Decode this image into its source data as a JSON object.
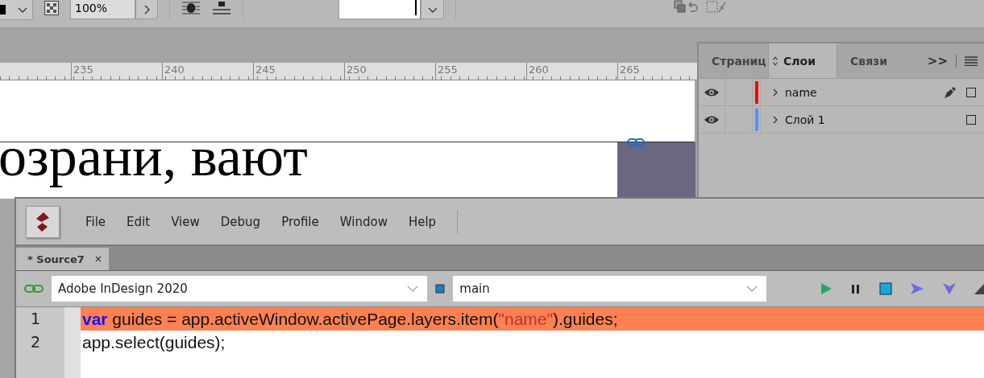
{
  "toolbar": {
    "opacity": "100%"
  },
  "ruler": {
    "labels": [
      "235",
      "240",
      "245",
      "250",
      "255",
      "260",
      "265"
    ]
  },
  "document": {
    "text": "озрани, вают"
  },
  "layers_panel": {
    "tabs": [
      {
        "label": "Страниц",
        "selected": false
      },
      {
        "label": "Слои",
        "selected": true
      },
      {
        "label": "Связи",
        "selected": false
      }
    ],
    "more": ">>",
    "layers": [
      {
        "name": "name",
        "visible": true,
        "color": "#ff0000",
        "current": true
      },
      {
        "name": "Слой 1",
        "visible": true,
        "color": "#4d94ff",
        "current": false
      }
    ]
  },
  "editor": {
    "menu": [
      "File",
      "Edit",
      "View",
      "Debug",
      "Profile",
      "Window",
      "Help"
    ],
    "tabs": [
      {
        "label": "* Source7",
        "selected": true
      }
    ],
    "target": "Adobe InDesign 2020",
    "engine": "main",
    "lines": [
      {
        "number": "1",
        "highlighted": true,
        "tokens": [
          {
            "kind": "keyword",
            "text": "var"
          },
          {
            "kind": "plain",
            "text": " guides = app.activeWindow.activePage.layers.item("
          },
          {
            "kind": "string",
            "text": "\"name\""
          },
          {
            "kind": "plain",
            "text": ").guides;"
          }
        ]
      },
      {
        "number": "2",
        "highlighted": false,
        "tokens": [
          {
            "kind": "plain",
            "text": "app.select(guides);"
          }
        ]
      }
    ]
  }
}
